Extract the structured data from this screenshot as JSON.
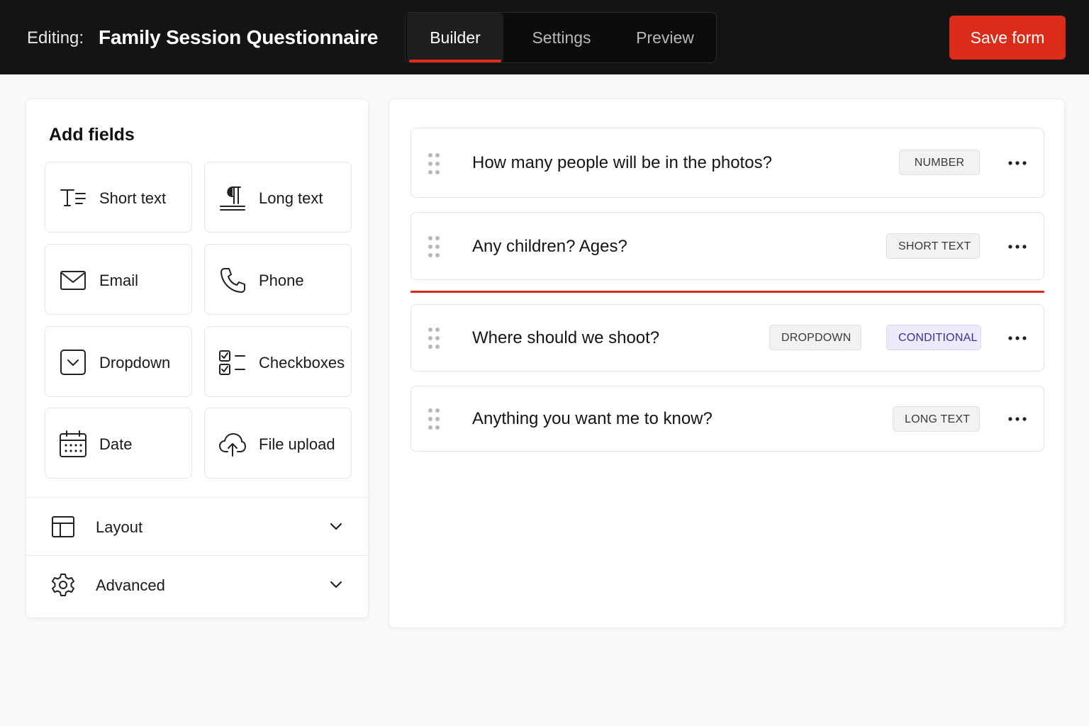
{
  "header": {
    "editing_label": "Editing:",
    "form_title": "Family Session Questionnaire",
    "tabs": [
      {
        "label": "Builder",
        "active": true
      },
      {
        "label": "Settings",
        "active": false
      },
      {
        "label": "Preview",
        "active": false
      }
    ],
    "save_label": "Save form"
  },
  "sidebar": {
    "title": "Add fields",
    "fields": [
      {
        "label": "Short text",
        "icon": "short-text-icon"
      },
      {
        "label": "Long text",
        "icon": "paragraph-icon"
      },
      {
        "label": "Email",
        "icon": "envelope-icon"
      },
      {
        "label": "Phone",
        "icon": "phone-icon"
      },
      {
        "label": "Dropdown",
        "icon": "dropdown-icon"
      },
      {
        "label": "Checkboxes",
        "icon": "checklist-icon"
      },
      {
        "label": "Date",
        "icon": "calendar-icon"
      },
      {
        "label": "File upload",
        "icon": "cloud-upload-icon"
      }
    ],
    "sections": [
      {
        "label": "Layout",
        "icon": "layout-icon"
      },
      {
        "label": "Advanced",
        "icon": "gear-icon"
      }
    ]
  },
  "canvas": {
    "questions": [
      {
        "text": "How many people will be in the photos?",
        "badges": [
          "NUMBER"
        ]
      },
      {
        "text": "Any children? Ages?",
        "badges": [
          "SHORT TEXT"
        ]
      },
      {
        "text": "Where should we shoot?",
        "badges": [
          "DROPDOWN",
          "CONDITIONAL"
        ]
      },
      {
        "text": "Anything you want me to know?",
        "badges": [
          "LONG TEXT"
        ]
      }
    ]
  },
  "colors": {
    "accent": "#db2c19",
    "topbar": "#141414",
    "conditional_badge": "#3a2f96"
  }
}
